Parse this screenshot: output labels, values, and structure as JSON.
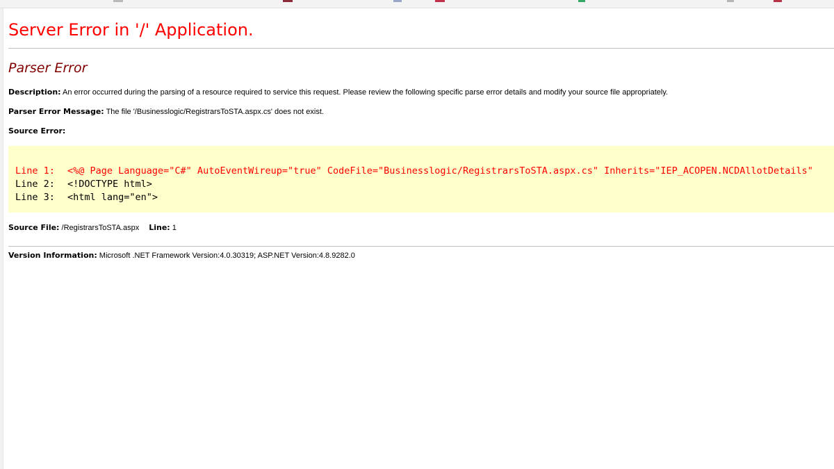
{
  "page": {
    "title": "Server Error in '/' Application.",
    "error_type": "Parser Error"
  },
  "description": {
    "label": "Description:",
    "text": "An error occurred during the parsing of a resource required to service this request. Please review the following specific parse error details and modify your source file appropriately."
  },
  "parser_message": {
    "label": "Parser Error Message:",
    "text": "The file '/Businesslogic/RegistrarsToSTA.aspx.cs' does not exist."
  },
  "source_error": {
    "label": "Source Error:",
    "lines": [
      {
        "number": "Line 1:",
        "code": "<%@ Page Language=\"C#\" AutoEventWireup=\"true\" CodeFile=\"Businesslogic/RegistrarsToSTA.aspx.cs\" Inherits=\"IEP_ACOPEN.NCDAllotDetails\""
      },
      {
        "number": "Line 2:",
        "code": "<!DOCTYPE html>"
      },
      {
        "number": "Line 3:",
        "code": "<html lang=\"en\">"
      }
    ]
  },
  "source_file": {
    "label": "Source File:",
    "value": "/RegistrarsToSTA.aspx",
    "line_label": "Line:",
    "line_value": "1"
  },
  "version": {
    "label": "Version Information:",
    "text": "Microsoft .NET Framework Version:4.0.30319; ASP.NET Version:4.8.9282.0"
  },
  "colors": {
    "title": "#ff0000",
    "heading": "#800000",
    "code_background": "#ffffcc",
    "error_line": "#ff0000"
  }
}
